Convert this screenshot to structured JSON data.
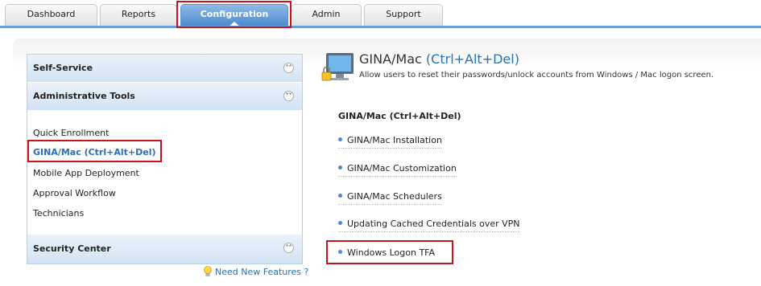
{
  "tabs": [
    {
      "label": "Dashboard"
    },
    {
      "label": "Reports"
    },
    {
      "label": "Configuration"
    },
    {
      "label": "Admin"
    },
    {
      "label": "Support"
    }
  ],
  "sidebar": {
    "self_service": "Self-Service",
    "admin_tools": "Administrative Tools",
    "items": [
      {
        "label": "Quick Enrollment"
      },
      {
        "label": "GINA/Mac (Ctrl+Alt+Del)"
      },
      {
        "label": "Mobile App Deployment"
      },
      {
        "label": "Approval Workflow"
      },
      {
        "label": "Technicians"
      }
    ],
    "security_center": "Security Center",
    "features_link": "Need New Features ?"
  },
  "main": {
    "title_prefix": "GINA/Mac",
    "title_paren": "(Ctrl+Alt+Del)",
    "description": "Allow users to reset their passwords/unlock accounts from Windows / Mac logon screen.",
    "section_title": "GINA/Mac (Ctrl+Alt+Del)",
    "links": [
      {
        "label": "GINA/Mac Installation"
      },
      {
        "label": "GINA/Mac Customization"
      },
      {
        "label": "GINA/Mac Schedulers"
      },
      {
        "label": "Updating Cached Credentials over VPN"
      },
      {
        "label": "Windows Logon TFA"
      }
    ]
  },
  "colors": {
    "accent": "#4d8ccf",
    "link": "#2a6fb5",
    "highlight": "#c4161c"
  }
}
